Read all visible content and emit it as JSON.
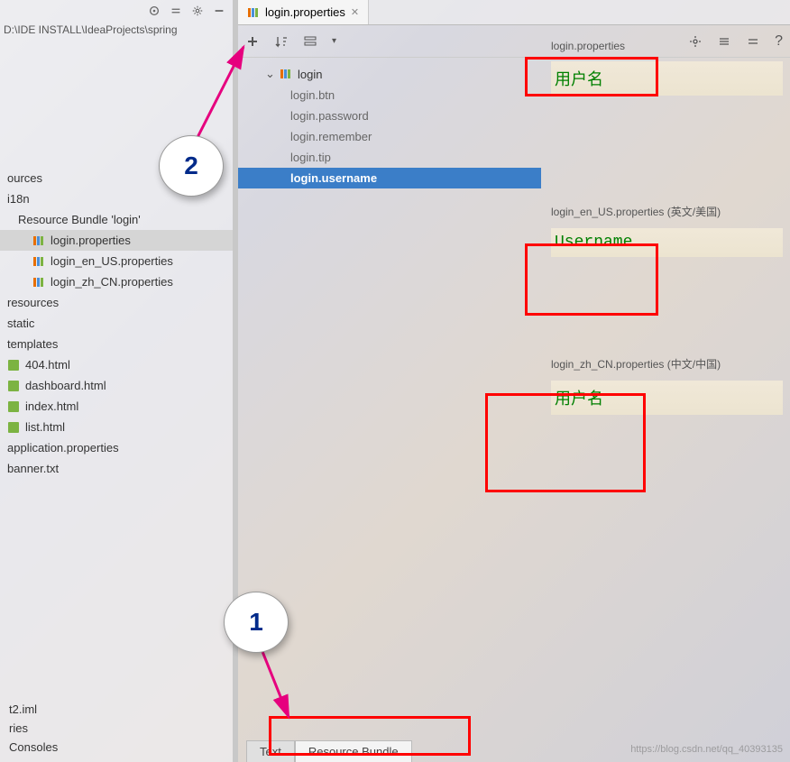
{
  "path": "D:\\IDE INSTALL\\IdeaProjects\\spring",
  "tab": {
    "label": "login.properties"
  },
  "sidebar": {
    "items": [
      "ources",
      "i18n",
      "Resource Bundle 'login'",
      "login.properties",
      "login_en_US.properties",
      "login_zh_CN.properties",
      "resources",
      "static",
      "templates",
      "404.html",
      "dashboard.html",
      "index.html",
      "list.html",
      "application.properties",
      "banner.txt"
    ]
  },
  "bottomLeft": [
    "t2.iml",
    "ries",
    "Consoles"
  ],
  "keys": {
    "root": "login",
    "children": [
      "login.btn",
      "login.password",
      "login.remember",
      "login.tip",
      "login.username"
    ],
    "selectedIndex": 4
  },
  "values": [
    {
      "file": "login.properties",
      "locale": "",
      "value": "用户名"
    },
    {
      "file": "login_en_US.properties",
      "locale": "(英文/美国)",
      "value": "Username"
    },
    {
      "file": "login_zh_CN.properties",
      "locale": "(中文/中国)",
      "value": "用户名"
    }
  ],
  "bottomTabs": {
    "text": "Text",
    "bundle": "Resource Bundle",
    "activeIndex": 1
  },
  "callouts": {
    "c1": "1",
    "c2": "2"
  },
  "watermark": "https://blog.csdn.net/qq_40393135"
}
